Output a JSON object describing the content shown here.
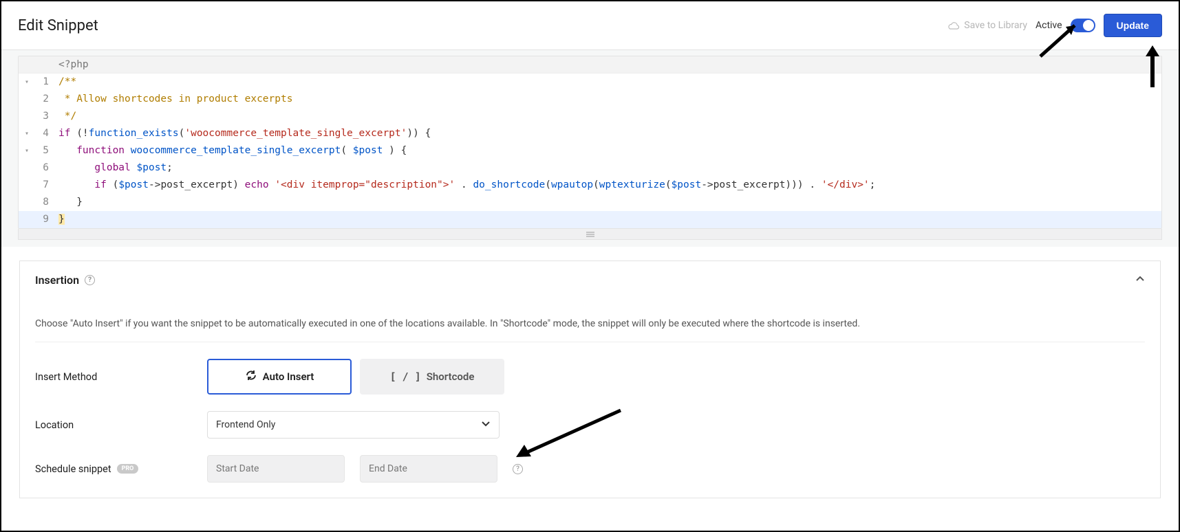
{
  "header": {
    "title": "Edit Snippet",
    "save_to_library": "Save to Library",
    "active_label": "Active",
    "update_label": "Update"
  },
  "code": {
    "php_open": "<?php",
    "lines": [
      {
        "n": 1,
        "fold": "▾",
        "segments": [
          {
            "cls": "tok-comment",
            "t": "/**"
          }
        ]
      },
      {
        "n": 2,
        "fold": "",
        "segments": [
          {
            "cls": "tok-comment",
            "t": " * Allow shortcodes in product excerpts"
          }
        ]
      },
      {
        "n": 3,
        "fold": "",
        "segments": [
          {
            "cls": "tok-comment",
            "t": " */"
          }
        ]
      },
      {
        "n": 4,
        "fold": "▾",
        "segments": [
          {
            "cls": "tok-keyword",
            "t": "if "
          },
          {
            "cls": "tok-punct",
            "t": "(!"
          },
          {
            "cls": "tok-func",
            "t": "function_exists"
          },
          {
            "cls": "tok-punct",
            "t": "("
          },
          {
            "cls": "tok-string",
            "t": "'woocommerce_template_single_excerpt'"
          },
          {
            "cls": "tok-punct",
            "t": ")) "
          },
          {
            "cls": "tok-brace",
            "t": "{"
          }
        ]
      },
      {
        "n": 5,
        "fold": "▾",
        "segments": [
          {
            "cls": "",
            "t": "   "
          },
          {
            "cls": "tok-keyword",
            "t": "function "
          },
          {
            "cls": "tok-func",
            "t": "woocommerce_template_single_excerpt"
          },
          {
            "cls": "tok-punct",
            "t": "( "
          },
          {
            "cls": "tok-var",
            "t": "$post"
          },
          {
            "cls": "tok-punct",
            "t": " ) "
          },
          {
            "cls": "tok-brace",
            "t": "{"
          }
        ]
      },
      {
        "n": 6,
        "fold": "",
        "segments": [
          {
            "cls": "",
            "t": "      "
          },
          {
            "cls": "tok-keyword",
            "t": "global "
          },
          {
            "cls": "tok-var",
            "t": "$post"
          },
          {
            "cls": "tok-punct",
            "t": ";"
          }
        ]
      },
      {
        "n": 7,
        "fold": "",
        "segments": [
          {
            "cls": "",
            "t": "      "
          },
          {
            "cls": "tok-keyword",
            "t": "if "
          },
          {
            "cls": "tok-punct",
            "t": "("
          },
          {
            "cls": "tok-var",
            "t": "$post"
          },
          {
            "cls": "tok-punct",
            "t": "->post_excerpt) "
          },
          {
            "cls": "tok-keyword",
            "t": "echo "
          },
          {
            "cls": "tok-string",
            "t": "'<div itemprop=\"description\">'"
          },
          {
            "cls": "tok-punct",
            "t": " . "
          },
          {
            "cls": "tok-func",
            "t": "do_shortcode"
          },
          {
            "cls": "tok-punct",
            "t": "("
          },
          {
            "cls": "tok-func",
            "t": "wpautop"
          },
          {
            "cls": "tok-punct",
            "t": "("
          },
          {
            "cls": "tok-func",
            "t": "wptexturize"
          },
          {
            "cls": "tok-punct",
            "t": "("
          },
          {
            "cls": "tok-var",
            "t": "$post"
          },
          {
            "cls": "tok-punct",
            "t": "->post_excerpt))) . "
          },
          {
            "cls": "tok-string",
            "t": "'</div>'"
          },
          {
            "cls": "tok-punct",
            "t": ";"
          }
        ]
      },
      {
        "n": 8,
        "fold": "",
        "segments": [
          {
            "cls": "",
            "t": "   "
          },
          {
            "cls": "tok-brace",
            "t": "}"
          }
        ]
      },
      {
        "n": 9,
        "fold": "",
        "highlight": true,
        "segments": [
          {
            "cls": "tok-brace tok-match",
            "t": "}"
          }
        ]
      }
    ]
  },
  "insertion": {
    "title": "Insertion",
    "description": "Choose \"Auto Insert\" if you want the snippet to be automatically executed in one of the locations available. In \"Shortcode\" mode, the snippet will only be executed where the shortcode is inserted.",
    "method_label": "Insert Method",
    "auto_insert": "Auto Insert",
    "shortcode": "Shortcode",
    "location_label": "Location",
    "location_value": "Frontend Only",
    "schedule_label": "Schedule snippet",
    "pro_label": "PRO",
    "start_placeholder": "Start Date",
    "end_placeholder": "End Date"
  }
}
